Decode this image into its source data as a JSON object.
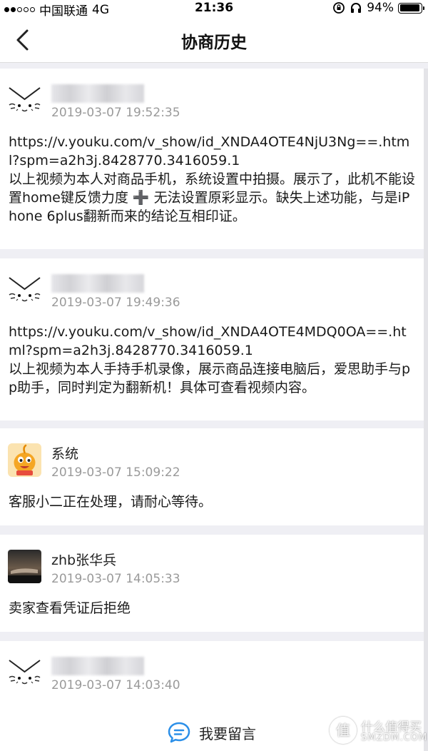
{
  "status_bar": {
    "carrier": "中国联通",
    "network": "4G",
    "time": "21:36",
    "battery": "94%",
    "battery_level": 0.94
  },
  "nav": {
    "title": "协商历史"
  },
  "messages": [
    {
      "sender": "",
      "avatar": "cat-face-icon",
      "time": "2019-03-07 19:52:35",
      "lines": [
        "https://v.youku.com/v_show/id_XNDA4OTE4NjU3Ng==.html?spm=a2h3j.8428770.3416059.1",
        "以上视频为本人对商品手机，系统设置中拍摄。展示了，此机不能设置home键反馈力度 ➕ 无法设置原彩显示。缺失上述功能，与是iPhone 6plus翻新而来的结论互相印证。"
      ]
    },
    {
      "sender": "",
      "avatar": "cat-face-icon",
      "time": "2019-03-07 19:49:36",
      "lines": [
        "https://v.youku.com/v_show/id_XNDA4OTE4MDQ0OA==.html?spm=a2h3j.8428770.3416059.1",
        "以上视频为本人手持手机录像，展示商品连接电脑后，爱思助手与pp助手，同时判定为翻新机！具体可查看视频内容。"
      ]
    },
    {
      "sender": "系统",
      "avatar": "taobao-mascot-icon",
      "time": "2019-03-07 15:09:22",
      "lines": [
        "客服小二正在处理，请耐心等待。"
      ]
    },
    {
      "sender": "zhb张华兵",
      "avatar": "seller-photo-avatar",
      "time": "2019-03-07 14:05:33",
      "lines": [
        "卖家查看凭证后拒绝"
      ]
    },
    {
      "sender": "",
      "avatar": "cat-face-icon",
      "time": "2019-03-07 14:03:40",
      "lines": []
    }
  ],
  "reply": {
    "label": "我要留言",
    "icon": "chat-bubble-icon"
  },
  "watermark": {
    "glyph": "值",
    "line1": "什么值得买",
    "line2": "SMZDM.COM"
  },
  "colors": {
    "background": "#efeff4",
    "card": "#ffffff",
    "timestamp": "#9a9a9a",
    "reply_icon": "#2b8fe8",
    "mascot": "#f5a623"
  }
}
